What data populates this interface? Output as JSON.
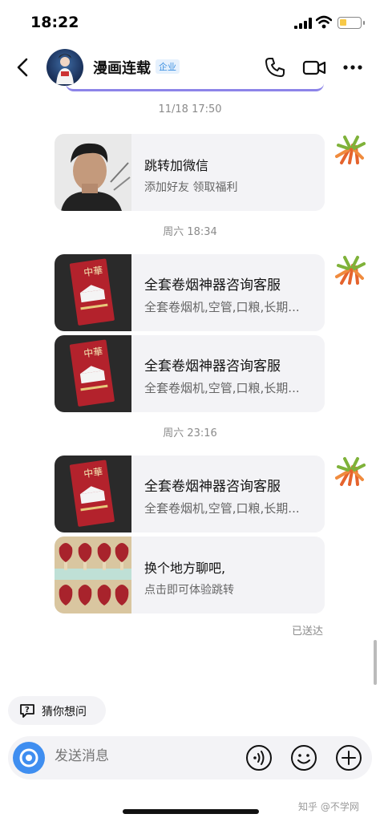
{
  "status_bar": {
    "time": "18:22"
  },
  "header": {
    "title": "漫画连载",
    "badge": "企业"
  },
  "messages": [
    {
      "type": "timestamp",
      "text": "11/18 17:50"
    },
    {
      "type": "card",
      "title": "跳转加微信",
      "subtitle": "添加好友 领取福利",
      "thumb": "man-portrait"
    },
    {
      "type": "timestamp",
      "text": "周六 18:34"
    },
    {
      "type": "card",
      "title": "全套卷烟神器咨询客服",
      "subtitle": "全套卷烟机,空管,口粮,长期...",
      "thumb": "cigarette-pack"
    },
    {
      "type": "card",
      "title": "全套卷烟神器咨询客服",
      "subtitle": "全套卷烟机,空管,口粮,长期...",
      "thumb": "cigarette-pack"
    },
    {
      "type": "timestamp",
      "text": "周六 23:16"
    },
    {
      "type": "card",
      "title": "全套卷烟神器咨询客服",
      "subtitle": "全套卷烟机,空管,口粮,长期...",
      "thumb": "cigarette-pack"
    },
    {
      "type": "card",
      "title": "换个地方聊吧,",
      "subtitle": "点击即可体验跳转",
      "thumb": "food-tray"
    }
  ],
  "delivery_status": "已送达",
  "suggestion": {
    "label": "猜你想问"
  },
  "input": {
    "placeholder": "发送消息"
  },
  "watermark": "知乎 @不学网",
  "colors": {
    "accent_blue": "#3f8ef0",
    "bubble_bg": "#f3f3f6",
    "badge_blue": "#3a8fe0"
  }
}
